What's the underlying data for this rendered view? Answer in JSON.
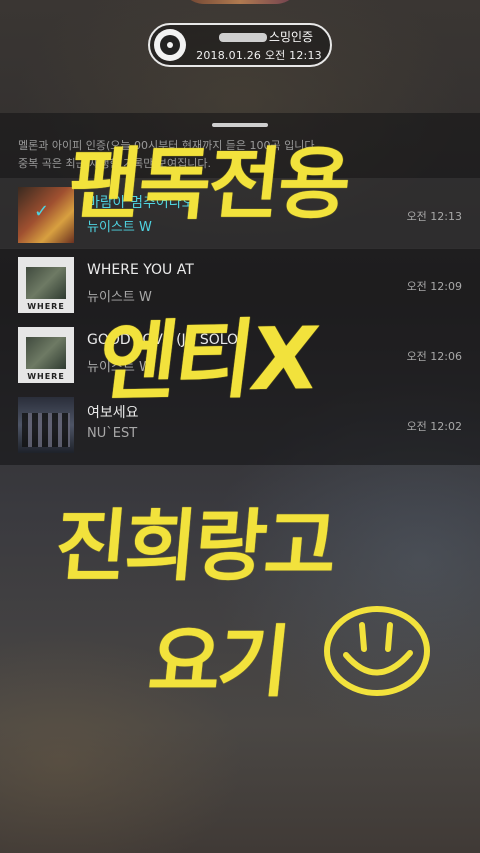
{
  "badge": {
    "name_label": "스밍인증",
    "datetime": "2018.01.26 오전 12:13"
  },
  "notice": {
    "line1": "멜론과 아이피 인증(오늘 00시부터 현재까지 듣은 100곡 입니다.",
    "line2": "중복 곡은 최근 재생한 기록만 보여집니다."
  },
  "tracks": [
    {
      "title": "바람아 멈추어다오",
      "artist": "뉴이스트 W",
      "time": "오전 12:13",
      "selected": true
    },
    {
      "title": "WHERE YOU AT",
      "artist": "뉴이스트 W",
      "time": "오전 12:09"
    },
    {
      "title": "GOOD LOVE (JR SOLO)",
      "artist": "뉴이스트 W",
      "time": "오전 12:06"
    },
    {
      "title": "여보세요",
      "artist": "NU`EST",
      "time": "오전 12:02"
    }
  ],
  "album_art": {
    "where_label": "WHERE"
  },
  "handwriting": {
    "line1": "팬독전용",
    "line2": "엔티X",
    "line3": "진희랑고",
    "line4": "요기"
  },
  "colors": {
    "accent": "#4fd3e0",
    "handwriting": "#f2e23c"
  }
}
